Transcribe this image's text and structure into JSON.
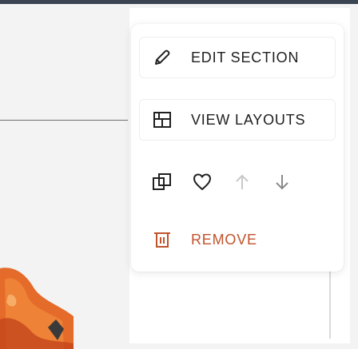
{
  "menu": {
    "edit_label": "EDIT SECTION",
    "layouts_label": "VIEW LAYOUTS",
    "remove_label": "REMOVE",
    "icons": {
      "edit": "pencil-icon",
      "layouts": "layout-grid-icon",
      "duplicate": "duplicate-icon",
      "favorite": "heart-icon",
      "move_up": "arrow-up-icon",
      "move_down": "arrow-down-icon",
      "remove": "trash-icon"
    }
  },
  "colors": {
    "top_border": "#3a4452",
    "text": "#202020",
    "danger": "#c0522c",
    "disabled_arrow": "#c8c8c8",
    "thumbnail_orange": "#e56b2a"
  }
}
